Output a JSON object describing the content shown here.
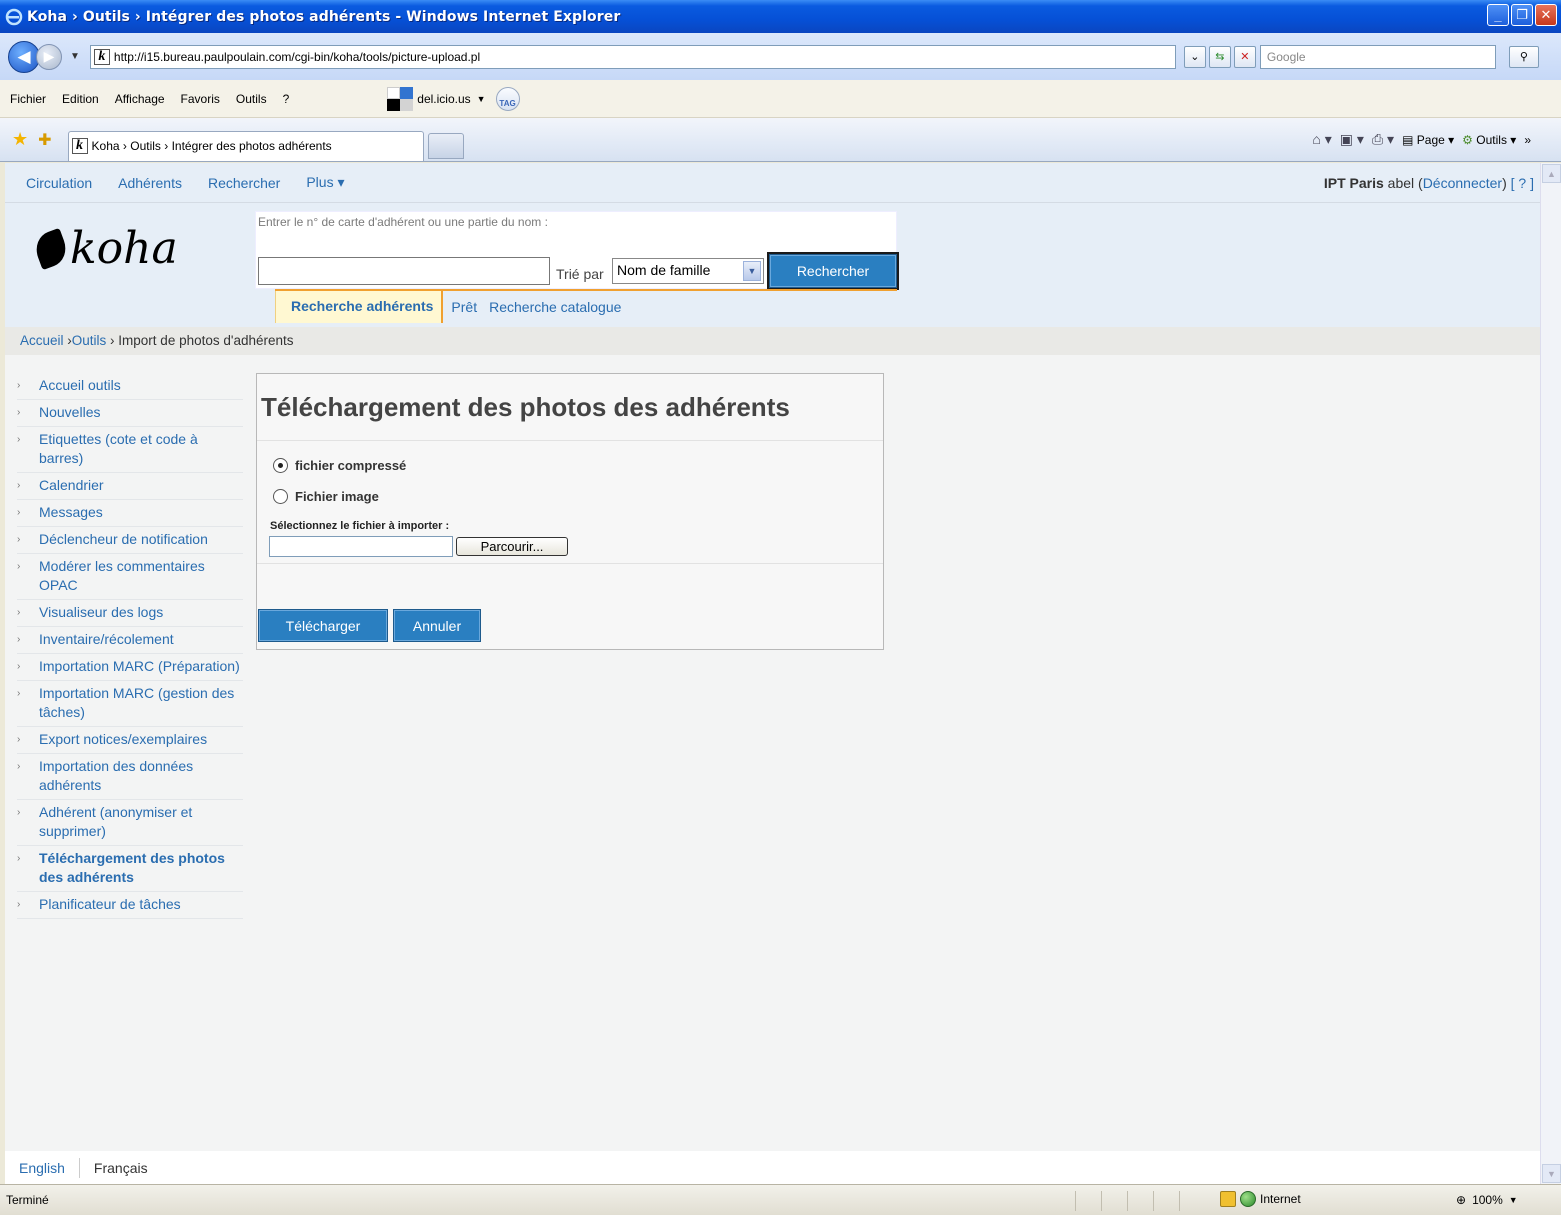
{
  "window": {
    "title": "Koha › Outils › Intégrer des photos adhérents - Windows Internet Explorer"
  },
  "browser": {
    "url": "http://i15.bureau.paulpoulain.com/cgi-bin/koha/tools/picture-upload.pl",
    "search_placeholder": "Google",
    "menus": [
      "Fichier",
      "Edition",
      "Affichage",
      "Favoris",
      "Outils",
      "?"
    ],
    "delicious_label": "del.icio.us",
    "tag_label": "TAG",
    "tab_title": "Koha › Outils › Intégrer des photos adhérents",
    "cmd_page": "Page",
    "cmd_tools": "Outils",
    "status_text": "Terminé",
    "zone_label": "Internet",
    "zoom_level": "100%"
  },
  "nav": {
    "items": [
      "Circulation",
      "Adhérents",
      "Rechercher",
      "Plus ▾"
    ],
    "library": "IPT Paris",
    "user": "abel",
    "logout": "Déconnecter",
    "help": "[ ? ]"
  },
  "header": {
    "logo_text": "koha",
    "search_hint": "Entrer le n° de carte d'adhérent ou une partie du nom :",
    "sort_label": "Trié par",
    "sort_value": "Nom de famille",
    "search_button": "Rechercher",
    "tabs": [
      "Recherche adhérents",
      "Prêt",
      "Recherche catalogue"
    ]
  },
  "breadcrumb": {
    "home": "Accueil",
    "tools": "Outils",
    "current": "Import de photos d'adhérents"
  },
  "sidebar": {
    "items": [
      "Accueil outils",
      "Nouvelles",
      "Etiquettes (cote et code à barres)",
      "Calendrier",
      "Messages",
      "Déclencheur de notification",
      "Modérer les commentaires OPAC",
      "Visualiseur des logs",
      "Inventaire/récolement",
      "Importation MARC (Préparation)",
      "Importation MARC (gestion des tâches)",
      "Export notices/exemplaires",
      "Importation des données adhérents",
      "Adhérent (anonymiser et supprimer)",
      "Téléchargement des photos des adhérents",
      "Planificateur de tâches"
    ],
    "current_index": 14
  },
  "upload": {
    "heading": "Téléchargement des photos des adhérents",
    "option_zip": "fichier compressé",
    "option_image": "Fichier image",
    "selected": "zip",
    "file_label": "Sélectionnez le fichier à importer :",
    "browse_button": "Parcourir...",
    "upload_button": "Télécharger",
    "cancel_button": "Annuler"
  },
  "footer": {
    "lang_en": "English",
    "lang_fr": "Français"
  }
}
